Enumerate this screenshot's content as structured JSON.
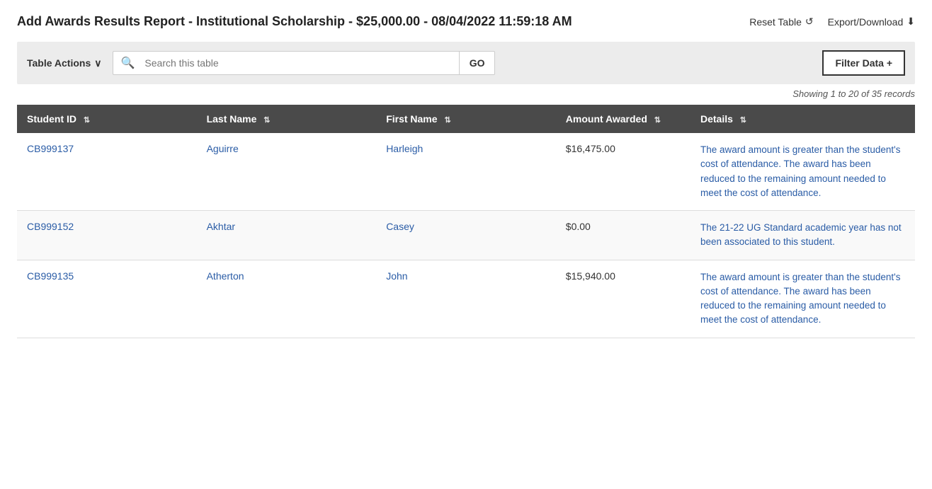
{
  "header": {
    "title": "Add Awards Results Report - Institutional Scholarship - $25,000.00 - 08/04/2022 11:59:18 AM",
    "reset_table_label": "Reset Table",
    "export_download_label": "Export/Download"
  },
  "toolbar": {
    "table_actions_label": "Table Actions",
    "search_placeholder": "Search this table",
    "go_label": "GO",
    "filter_data_label": "Filter Data +"
  },
  "records_info": "Showing 1 to 20 of 35 records",
  "table": {
    "columns": [
      {
        "id": "student_id",
        "label": "Student ID",
        "sortable": true
      },
      {
        "id": "last_name",
        "label": "Last Name",
        "sortable": true
      },
      {
        "id": "first_name",
        "label": "First Name",
        "sortable": true
      },
      {
        "id": "amount",
        "label": "Amount Awarded",
        "sortable": true
      },
      {
        "id": "details",
        "label": "Details",
        "sortable": true
      }
    ],
    "rows": [
      {
        "student_id": "CB999137",
        "last_name": "Aguirre",
        "first_name": "Harleigh",
        "amount": "$16,475.00",
        "details": "The award amount is greater than the student's cost of attendance. The award has been reduced to the remaining amount needed to meet the cost of attendance."
      },
      {
        "student_id": "CB999152",
        "last_name": "Akhtar",
        "first_name": "Casey",
        "amount": "$0.00",
        "details": "The 21-22 UG Standard academic year has not been associated to this student."
      },
      {
        "student_id": "CB999135",
        "last_name": "Atherton",
        "first_name": "John",
        "amount": "$15,940.00",
        "details": "The award amount is greater than the student's cost of attendance. The award has been reduced to the remaining amount needed to meet the cost of attendance."
      }
    ]
  },
  "icons": {
    "reset": "↺",
    "download": "⬇",
    "chevron_down": "∨",
    "search": "🔍",
    "sort": "⇅"
  }
}
